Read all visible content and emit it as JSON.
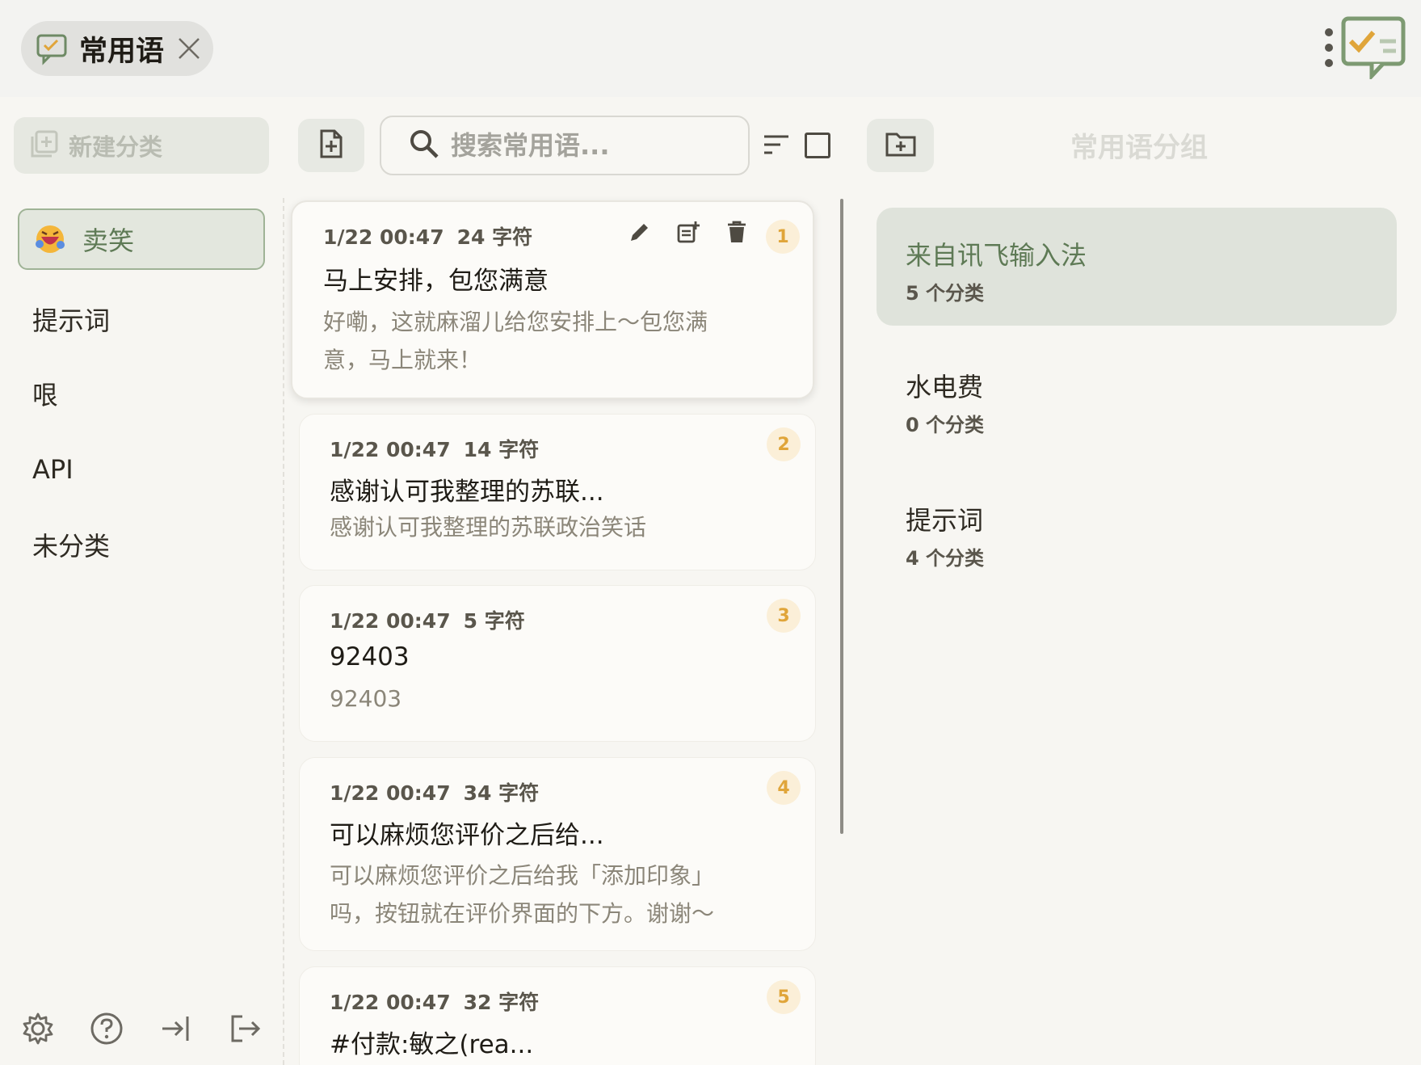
{
  "tab": {
    "label": "常用语"
  },
  "toolbar": {
    "new_category": "新建分类",
    "search_placeholder": "搜索常用语..."
  },
  "groups_header": "常用语分组",
  "categories": [
    {
      "label": "卖笑",
      "active": true
    },
    {
      "label": "提示词"
    },
    {
      "label": "哏"
    },
    {
      "label": "API"
    },
    {
      "label": "未分类"
    }
  ],
  "items": [
    {
      "time": "1/22 00:47",
      "count": "24 字符",
      "title": "马上安排，包您满意",
      "content": "好嘞，这就麻溜儿给您安排上～包您满意，马上就来！",
      "index": "1"
    },
    {
      "time": "1/22 00:47",
      "count": "14 字符",
      "title": "感谢认可我整理的苏联...",
      "content": "感谢认可我整理的苏联政治笑话",
      "index": "2"
    },
    {
      "time": "1/22 00:47",
      "count": "5 字符",
      "title": "92403",
      "content": "92403",
      "index": "3"
    },
    {
      "time": "1/22 00:47",
      "count": "34 字符",
      "title": "可以麻烦您评价之后给...",
      "content": "可以麻烦您评价之后给我「添加印象」吗，按钮就在评价界面的下方。谢谢～",
      "index": "4"
    },
    {
      "time": "1/22 00:47",
      "count": "32 字符",
      "title": "#付款:敏之(rea...",
      "content": "",
      "index": "5"
    }
  ],
  "groups": [
    {
      "name": "来自讯飞输入法",
      "count": "5 个分类",
      "active": true
    },
    {
      "name": "水电费",
      "count": "0 个分类"
    },
    {
      "name": "提示词",
      "count": "4 个分类"
    }
  ],
  "colors": {
    "accent": "#5e7a55",
    "badge": "#e0a53a",
    "background": "#f7f6f2"
  }
}
